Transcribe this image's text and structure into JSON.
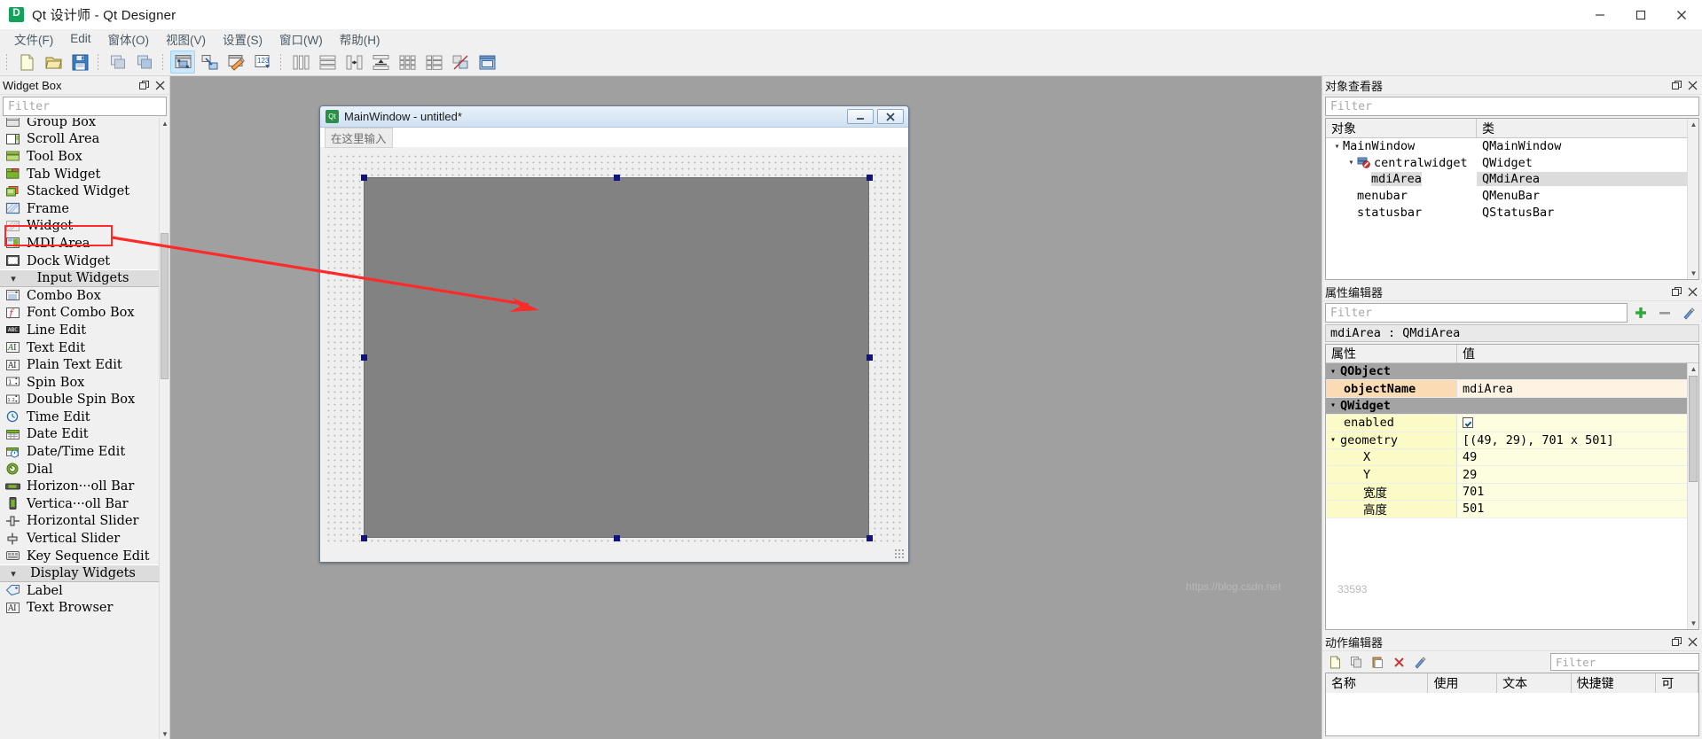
{
  "window": {
    "title": "Qt 设计师 - Qt Designer",
    "icon": "designer-app-icon",
    "minimize": "−",
    "maximize": "□",
    "close": "✕"
  },
  "menubar": {
    "items": [
      {
        "label": "文件(F)",
        "mnemonic": "F"
      },
      {
        "label": "Edit",
        "mnemonic": "E"
      },
      {
        "label": "窗体(O)",
        "mnemonic": "O"
      },
      {
        "label": "视图(V)",
        "mnemonic": "V"
      },
      {
        "label": "设置(S)",
        "mnemonic": "S"
      },
      {
        "label": "窗口(W)",
        "mnemonic": "W"
      },
      {
        "label": "帮助(H)",
        "mnemonic": "H"
      }
    ]
  },
  "toolbar": {
    "groups": [
      {
        "buttons": [
          {
            "name": "new-form-icon"
          },
          {
            "name": "open-form-icon"
          },
          {
            "name": "save-form-icon"
          }
        ]
      },
      {
        "buttons": [
          {
            "name": "undo-icon"
          },
          {
            "name": "redo-icon"
          }
        ]
      },
      {
        "buttons": [
          {
            "name": "edit-widgets-icon",
            "active": true
          },
          {
            "name": "edit-signals-slots-icon",
            "active": false
          },
          {
            "name": "edit-buddies-icon",
            "active": false
          },
          {
            "name": "edit-tab-order-icon",
            "active": false
          }
        ]
      },
      {
        "buttons": [
          {
            "name": "layout-horizontally-icon"
          },
          {
            "name": "layout-vertically-icon"
          },
          {
            "name": "layout-splitter-horizontal-icon"
          },
          {
            "name": "layout-splitter-vertical-icon"
          },
          {
            "name": "layout-grid-icon"
          },
          {
            "name": "layout-form-icon"
          },
          {
            "name": "break-layout-icon"
          },
          {
            "name": "adjust-size-icon"
          }
        ]
      }
    ]
  },
  "widget_box": {
    "title": "Widget Box",
    "float_button": "float-icon",
    "close_button": "close-icon",
    "filter_placeholder": "Filter",
    "items": [
      {
        "label": "Group Box",
        "icon": "group-box-icon",
        "type": "item",
        "clipped": true
      },
      {
        "label": "Scroll Area",
        "icon": "scroll-area-icon",
        "type": "item"
      },
      {
        "label": "Tool Box",
        "icon": "tool-box-icon",
        "type": "item"
      },
      {
        "label": "Tab Widget",
        "icon": "tab-widget-icon",
        "type": "item"
      },
      {
        "label": "Stacked Widget",
        "icon": "stacked-widget-icon",
        "type": "item"
      },
      {
        "label": "Frame",
        "icon": "frame-icon",
        "type": "item"
      },
      {
        "label": "Widget",
        "icon": "widget-icon",
        "type": "item"
      },
      {
        "label": "MDI Area",
        "icon": "mdi-area-icon",
        "type": "item",
        "highlighted": true
      },
      {
        "label": "Dock Widget",
        "icon": "dock-widget-icon",
        "type": "item"
      },
      {
        "label": "Input Widgets",
        "type": "category"
      },
      {
        "label": "Combo Box",
        "icon": "combo-box-icon",
        "type": "item"
      },
      {
        "label": "Font Combo Box",
        "icon": "font-combo-box-icon",
        "type": "item"
      },
      {
        "label": "Line Edit",
        "icon": "line-edit-icon",
        "type": "item"
      },
      {
        "label": "Text Edit",
        "icon": "text-edit-icon",
        "type": "item"
      },
      {
        "label": "Plain Text Edit",
        "icon": "plain-text-edit-icon",
        "type": "item"
      },
      {
        "label": "Spin Box",
        "icon": "spin-box-icon",
        "type": "item"
      },
      {
        "label": "Double Spin Box",
        "icon": "double-spin-box-icon",
        "type": "item"
      },
      {
        "label": "Time Edit",
        "icon": "time-edit-icon",
        "type": "item"
      },
      {
        "label": "Date Edit",
        "icon": "date-edit-icon",
        "type": "item"
      },
      {
        "label": "Date/Time Edit",
        "icon": "date-time-edit-icon",
        "type": "item"
      },
      {
        "label": "Dial",
        "icon": "dial-icon",
        "type": "item"
      },
      {
        "label": "Horizon···oll Bar",
        "icon": "horizontal-scroll-bar-icon",
        "type": "item"
      },
      {
        "label": "Vertica···oll Bar",
        "icon": "vertical-scroll-bar-icon",
        "type": "item"
      },
      {
        "label": "Horizontal Slider",
        "icon": "horizontal-slider-icon",
        "type": "item"
      },
      {
        "label": "Vertical Slider",
        "icon": "vertical-slider-icon",
        "type": "item"
      },
      {
        "label": "Key Sequence Edit",
        "icon": "key-sequence-edit-icon",
        "type": "item"
      },
      {
        "label": "Display Widgets",
        "type": "category"
      },
      {
        "label": "Label",
        "icon": "label-icon",
        "type": "item"
      },
      {
        "label": "Text Browser",
        "icon": "text-browser-icon",
        "type": "item"
      }
    ]
  },
  "form_window": {
    "title": "MainWindow - untitled*",
    "icon": "qt-logo-icon",
    "minimize": "−",
    "close": "✕",
    "menu_placeholder": "在这里输入",
    "central_widget_name": "mdiArea"
  },
  "object_inspector": {
    "title": "对象查看器",
    "float_button": "float-icon",
    "close_button": "close-icon",
    "filter_placeholder": "Filter",
    "columns": [
      "对象",
      "类"
    ],
    "rows": [
      {
        "name": "MainWindow",
        "class": "QMainWindow",
        "depth": 0,
        "expanded": true,
        "icon": null,
        "selected": false
      },
      {
        "name": "centralwidget",
        "class": "QWidget",
        "depth": 1,
        "expanded": true,
        "icon": "central-widget-icon",
        "selected": false
      },
      {
        "name": "mdiArea",
        "class": "QMdiArea",
        "depth": 2,
        "expanded": false,
        "icon": null,
        "selected": true
      },
      {
        "name": "menubar",
        "class": "QMenuBar",
        "depth": 1,
        "expanded": false,
        "icon": null,
        "selected": false
      },
      {
        "name": "statusbar",
        "class": "QStatusBar",
        "depth": 1,
        "expanded": false,
        "icon": null,
        "selected": false
      }
    ]
  },
  "property_editor": {
    "title": "属性编辑器",
    "float_button": "float-icon",
    "close_button": "close-icon",
    "filter_placeholder": "Filter",
    "add_button": "add-property-icon",
    "remove_button": "remove-property-icon",
    "configure_button": "configure-icon",
    "object_line": "mdiArea : QMdiArea",
    "columns": [
      "属性",
      "值"
    ],
    "rows": [
      {
        "key": "QObject",
        "value": "",
        "style": "group",
        "arrow": "expanded",
        "indent": 0
      },
      {
        "key": "objectName",
        "value": "mdiArea",
        "style": "mod",
        "arrow": "none",
        "indent": 1
      },
      {
        "key": "QWidget",
        "value": "",
        "style": "group",
        "arrow": "expanded",
        "indent": 0
      },
      {
        "key": "enabled",
        "value": "checkbox",
        "style": "yel",
        "arrow": "none",
        "indent": 1
      },
      {
        "key": "geometry",
        "value": "[(49, 29), 701 x 501]",
        "style": "yel",
        "arrow": "expanded",
        "indent": 0
      },
      {
        "key": "X",
        "value": "49",
        "style": "yel",
        "arrow": "none",
        "indent": 2
      },
      {
        "key": "Y",
        "value": "29",
        "style": "yel",
        "arrow": "none",
        "indent": 2
      },
      {
        "key": "宽度",
        "value": "701",
        "style": "yel",
        "arrow": "none",
        "indent": 2
      },
      {
        "key": "高度",
        "value": "501",
        "style": "yel",
        "arrow": "none",
        "indent": 2
      }
    ]
  },
  "action_editor": {
    "title": "动作编辑器",
    "float_button": "float-icon",
    "close_button": "close-icon",
    "filter_placeholder": "Filter",
    "buttons": [
      {
        "name": "new-action-icon"
      },
      {
        "name": "copy-action-icon"
      },
      {
        "name": "paste-action-icon"
      },
      {
        "name": "delete-action-icon"
      },
      {
        "name": "edit-action-icon"
      }
    ],
    "columns": [
      "名称",
      "使用",
      "文本",
      "快捷键",
      "可"
    ]
  },
  "annotation": {
    "arrow_color": "#ff2a2a",
    "highlight_color": "#ff2a2a"
  },
  "watermark": {
    "text_a": "https://blog.csdn.net",
    "text_b": "33593"
  }
}
